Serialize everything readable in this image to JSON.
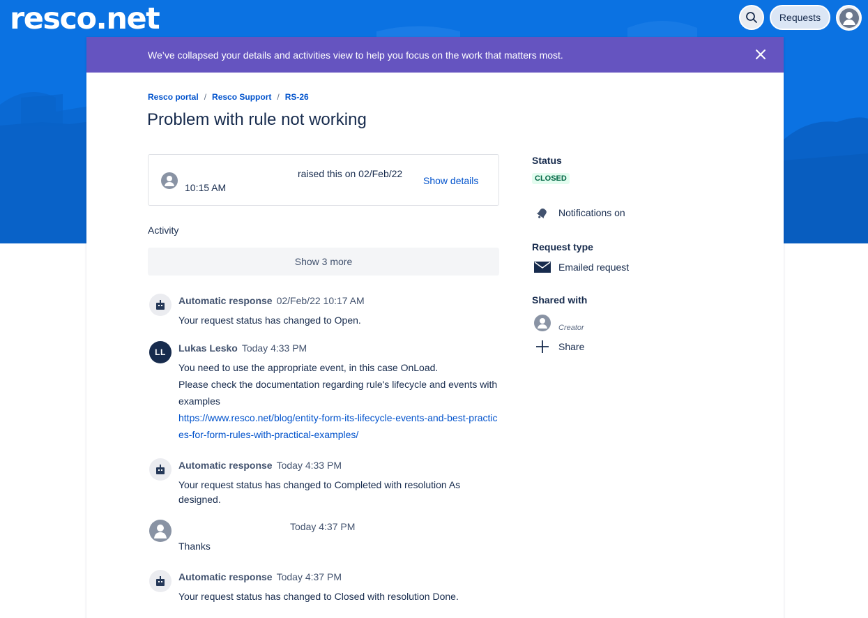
{
  "header": {
    "logo_text": "resco.net",
    "search_icon": "search-icon",
    "requests_label": "Requests",
    "profile_icon": "user-avatar-icon"
  },
  "banner": {
    "text": "We’ve collapsed your details and activities view to help you focus on the work that matters most.",
    "close_icon": "close-icon"
  },
  "breadcrumb": [
    {
      "label": "Resco portal"
    },
    {
      "label": "Resco Support"
    },
    {
      "label": "RS-26"
    }
  ],
  "request": {
    "title": "Problem with rule not working",
    "time": "10:15 AM",
    "raised_text": "raised this on 02/Feb/22",
    "show_details_label": "Show details"
  },
  "activity": {
    "heading": "Activity",
    "show_more_label": "Show 3 more",
    "items": [
      {
        "author": "Automatic response",
        "timestamp": "02/Feb/22 10:17 AM",
        "lines": [
          "Your request status has changed to Open."
        ]
      },
      {
        "author": "Lukas Lesko",
        "initials": "LL",
        "timestamp": "Today 4:33 PM",
        "lines": [
          "You need to use the appropriate event, in this case OnLoad.",
          "Please check the documentation regarding rule's lifecycle and events with examples"
        ],
        "link": "https://www.resco.net/blog/entity-form-its-lifecycle-events-and-best-practices-for-form-rules-with-practical-examples/"
      },
      {
        "author": "Automatic response",
        "timestamp": "Today 4:33 PM",
        "lines": [
          "Your request status has changed to Completed with resolution As designed."
        ]
      },
      {
        "author": "",
        "timestamp": "Today 4:37 PM",
        "lines": [
          "Thanks"
        ]
      },
      {
        "author": "Automatic response",
        "timestamp": "Today 4:37 PM",
        "lines": [
          "Your request status has changed to Closed with resolution Done."
        ]
      }
    ]
  },
  "sidebar": {
    "status_heading": "Status",
    "status_value": "CLOSED",
    "status_color": "#006644",
    "notifications_label": "Notifications on",
    "request_type_heading": "Request type",
    "request_type_value": "Emailed request",
    "shared_with_heading": "Shared with",
    "creator_label": "Creator",
    "share_label": "Share"
  },
  "colors": {
    "brand_blue": "#0b72e2",
    "banner_purple": "#6554c0",
    "link_blue": "#0052cc",
    "text_dark": "#172b4d"
  }
}
